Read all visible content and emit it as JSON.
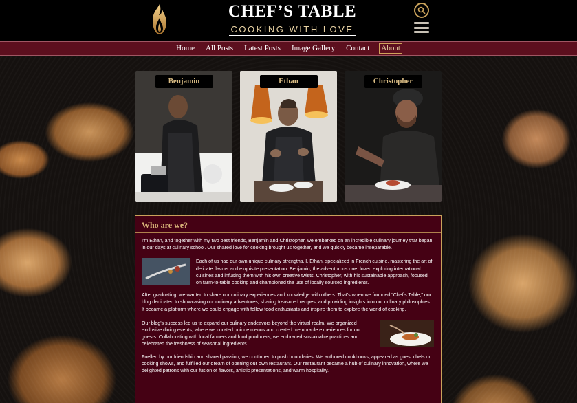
{
  "brand": {
    "title": "CHEF’S TABLE",
    "subtitle": "COOKING WITH LOVE"
  },
  "icons": {
    "logo": "flame-logo-icon",
    "search": "search-icon",
    "menu": "hamburger-menu-icon"
  },
  "nav": {
    "items": [
      {
        "label": "Home"
      },
      {
        "label": "All Posts"
      },
      {
        "label": "Latest Posts"
      },
      {
        "label": "Image Gallery"
      },
      {
        "label": "Contact"
      },
      {
        "label": "About"
      }
    ],
    "active": "About"
  },
  "chefs": [
    {
      "name": "Benjamin"
    },
    {
      "name": "Ethan"
    },
    {
      "name": "Christopher"
    }
  ],
  "about": {
    "heading": "Who are we?",
    "p1": "I'm Ethan, and together with my two best friends, Benjamin and Christopher, we embarked on an incredible culinary journey that began in our days at culinary school. Our shared love for cooking brought us together, and we quickly became inseparable.",
    "p2": "Each of us had our own unique culinary strengths. I, Ethan, specialized in French cuisine, mastering the art of delicate flavors and exquisite presentation. Benjamin, the adventurous one, loved exploring international cuisines and infusing them with his own creative twists. Christopher, with his sustainable approach, focused on farm-to-table cooking and championed the use of locally sourced ingredients.",
    "p3": "After graduating, we wanted to share our culinary experiences and knowledge with others. That's when we founded \"Chef's Table,\" our blog dedicated to showcasing our culinary adventures, sharing treasured recipes, and providing insights into our culinary philosophies. It became a platform where we could engage with fellow food enthusiasts and inspire them to explore the world of cooking.",
    "p4": "Our blog's success led us to expand our culinary endeavors beyond the virtual realm. We organized exclusive dining events, where we curated unique menus and created memorable experiences for our guests. Collaborating with local farmers and food producers, we embraced sustainable practices and celebrated the freshness of seasonal ingredients.",
    "p5": "Fuelled by our friendship and shared passion, we continued to push boundaries. We authored cookbooks, appeared as guest chefs on cooking shows, and fulfilled our dream of opening our own restaurant. Our restaurant became a hub of culinary innovation, where we delighted patrons with our fusion of flavors, artistic presentations, and warm hospitality."
  },
  "colors": {
    "header_bg": "#000000",
    "nav_bg": "#5c0f1e",
    "panel_bg": "#490014",
    "gold": "#c9a25b"
  }
}
